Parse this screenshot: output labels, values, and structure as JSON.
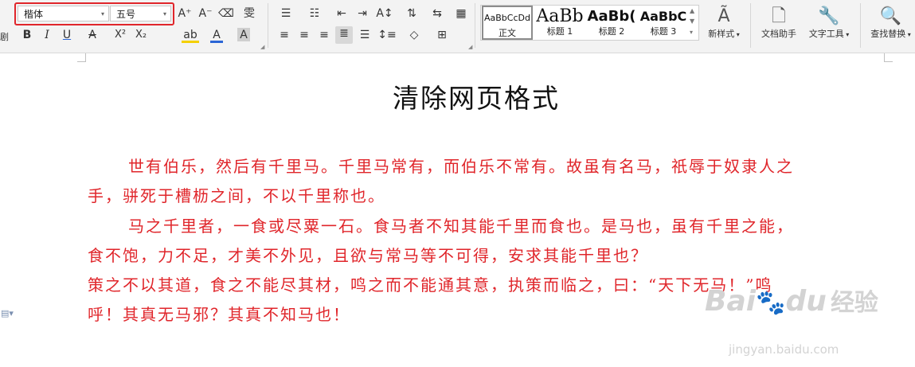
{
  "toolbar": {
    "font_name": "楷体",
    "font_size": "五号",
    "icons": {
      "increase_font": "A⁺",
      "decrease_font": "A⁻",
      "clear_format": "eraser-icon",
      "pinyin": "雯",
      "bold": "B",
      "italic": "I",
      "underline": "U",
      "strikethrough": "A",
      "superscript": "X²",
      "subscript": "X₂",
      "highlight": "ab",
      "font_color": "A",
      "char_shading": "A"
    }
  },
  "styles": {
    "items": [
      {
        "preview": "AaBbCcDd",
        "name": "正文"
      },
      {
        "preview": "AaBb",
        "name": "标题 1"
      },
      {
        "preview": "AaBb(",
        "name": "标题 2"
      },
      {
        "preview": "AaBbC",
        "name": "标题 3"
      }
    ],
    "new_style": "新样式",
    "doc_helper": "文档助手",
    "text_tools": "文字工具",
    "find_replace": "查找替换"
  },
  "document": {
    "title": "清除网页格式",
    "lines": [
      "世有伯乐，然后有千里马。千里马常有，而伯乐不常有。故虽有名马，祇辱于奴隶人之",
      "手，骈死于槽枥之间，不以千里称也。",
      "马之千里者，一食或尽粟一石。食马者不知其能千里而食也。是马也，虽有千里之能，",
      "食不饱，力不足，才美不外见，且欲与常马等不可得，安求其能千里也？",
      "策之不以其道，食之不能尽其材，鸣之而不能通其意，执策而临之，曰：“天下无马！”鸣",
      "呼！其真无马邪？其真不知马也！"
    ],
    "text_color": "#e0262b"
  },
  "watermark": {
    "brand": "Bai",
    "brand_mid": "du",
    "brand_cn": "经验",
    "url": "jingyan.baidu.com"
  },
  "colors": {
    "highlight_border": "#e0262b",
    "underline_blue": "#2b66d6",
    "highlighter": "#f4d000"
  }
}
